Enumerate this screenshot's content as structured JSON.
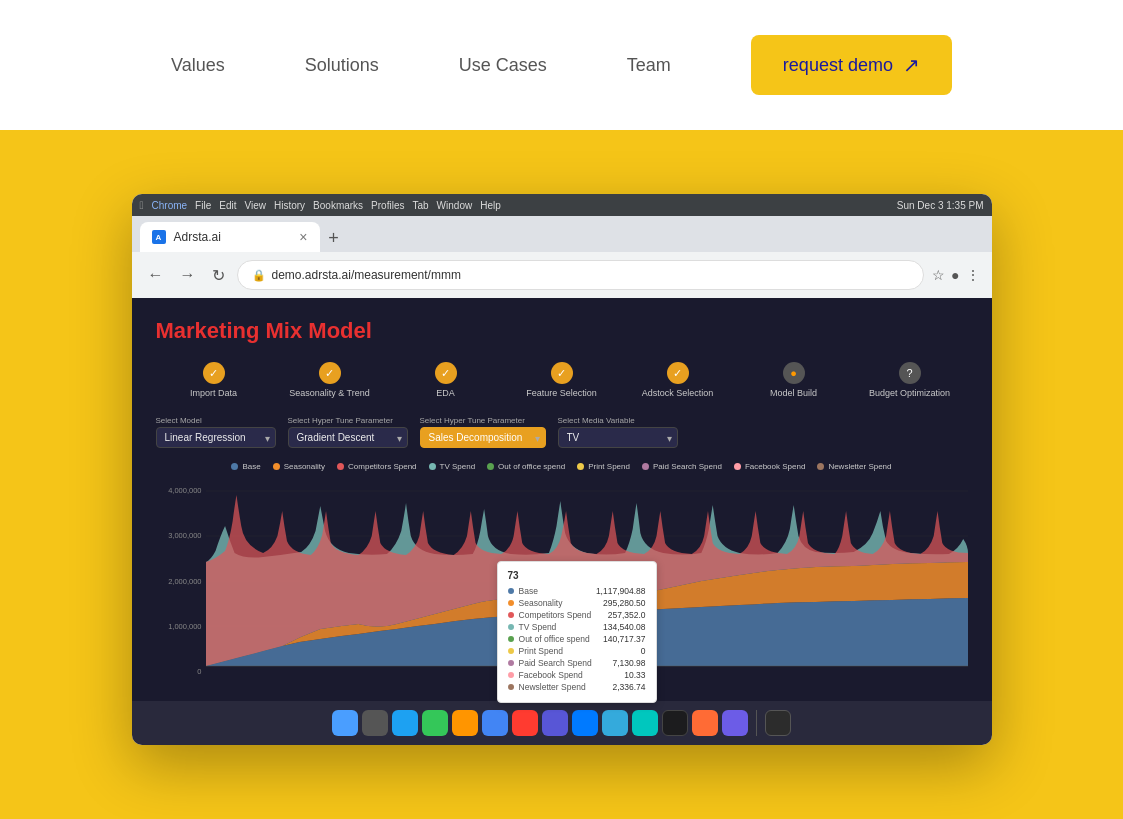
{
  "header": {
    "nav_items": [
      {
        "label": "Values",
        "id": "values"
      },
      {
        "label": "Solutions",
        "id": "solutions"
      },
      {
        "label": "Use Cases",
        "id": "use-cases"
      },
      {
        "label": "Team",
        "id": "team"
      }
    ],
    "cta_label": "request demo",
    "cta_arrow": "↗"
  },
  "browser": {
    "os_bar": {
      "menu_items": [
        "Chrome",
        "File",
        "Edit",
        "View",
        "History",
        "Bookmarks",
        "Profiles",
        "Tab",
        "Window",
        "Help"
      ],
      "time": "Sun Dec 3  1:35 PM"
    },
    "tab": {
      "title": "Adrsta.ai",
      "favicon_label": "A"
    },
    "address_bar": {
      "url": "demo.adrsta.ai/measurement/mmm"
    }
  },
  "app": {
    "title": "Marketing Mix Model",
    "workflow_steps": [
      {
        "label": "Import Data",
        "state": "completed"
      },
      {
        "label": "Seasonality & Trend",
        "state": "completed"
      },
      {
        "label": "EDA",
        "state": "completed"
      },
      {
        "label": "Feature Selection",
        "state": "completed"
      },
      {
        "label": "Adstock Selection",
        "state": "completed"
      },
      {
        "label": "Model Build",
        "state": "pending"
      },
      {
        "label": "Budget Optimization",
        "state": "question"
      }
    ],
    "controls": [
      {
        "label": "Select Model",
        "value": "Linear Regression",
        "highlighted": false
      },
      {
        "label": "Select Hyper Tune Parameter",
        "value": "Gradient Descent",
        "highlighted": false
      },
      {
        "label": "Select Hyper Tune Parameter",
        "value": "Sales Decomposition",
        "highlighted": true
      },
      {
        "label": "Select Media Variable",
        "value": "TV",
        "highlighted": false
      }
    ],
    "legend": [
      {
        "label": "Base",
        "color": "#4e79a7"
      },
      {
        "label": "Seasonality",
        "color": "#f28e2b"
      },
      {
        "label": "Competitors Spend",
        "color": "#e15759"
      },
      {
        "label": "TV Spend",
        "color": "#76b7b2"
      },
      {
        "label": "Out of office spend",
        "color": "#59a14f"
      },
      {
        "label": "Print Spend",
        "color": "#edc948"
      },
      {
        "label": "Paid Search Spend",
        "color": "#b07aa1"
      },
      {
        "label": "Facebook Spend",
        "color": "#ff9da7"
      },
      {
        "label": "Newsletter Spend",
        "color": "#9c755f"
      }
    ],
    "y_axis_labels": [
      "4,000,000",
      "3,000,000",
      "2,000,000",
      "1,000,000",
      "0"
    ],
    "tooltip": {
      "header": "73",
      "rows": [
        {
          "label": "Base",
          "value": "1,117,904.88",
          "color": "#4e79a7"
        },
        {
          "label": "Seasonality",
          "value": "295,280.50",
          "color": "#f28e2b"
        },
        {
          "label": "Competitors Spend",
          "value": "257,352.0",
          "color": "#e15759"
        },
        {
          "label": "TV Spend",
          "value": "134,540.08",
          "color": "#76b7b2"
        },
        {
          "label": "Out of office spend",
          "value": "140,717.37",
          "color": "#59a14f"
        },
        {
          "label": "Print Spend",
          "value": "0",
          "color": "#edc948"
        },
        {
          "label": "Paid Search Spend",
          "value": "7,130.98",
          "color": "#b07aa1"
        },
        {
          "label": "Facebook Spend",
          "value": "10.33",
          "color": "#ff9da7"
        },
        {
          "label": "Newsletter Spend",
          "value": "2,336.74",
          "color": "#9c755f"
        }
      ]
    }
  },
  "colors": {
    "header_bg": "#ffffff",
    "hero_bg": "#F5C518",
    "nav_text": "#666666",
    "cta_bg": "#F5C518",
    "cta_text": "#1a1a9e",
    "browser_chrome": "#3c4043",
    "app_bg": "#1a1a2e",
    "app_title": "#e83030"
  }
}
